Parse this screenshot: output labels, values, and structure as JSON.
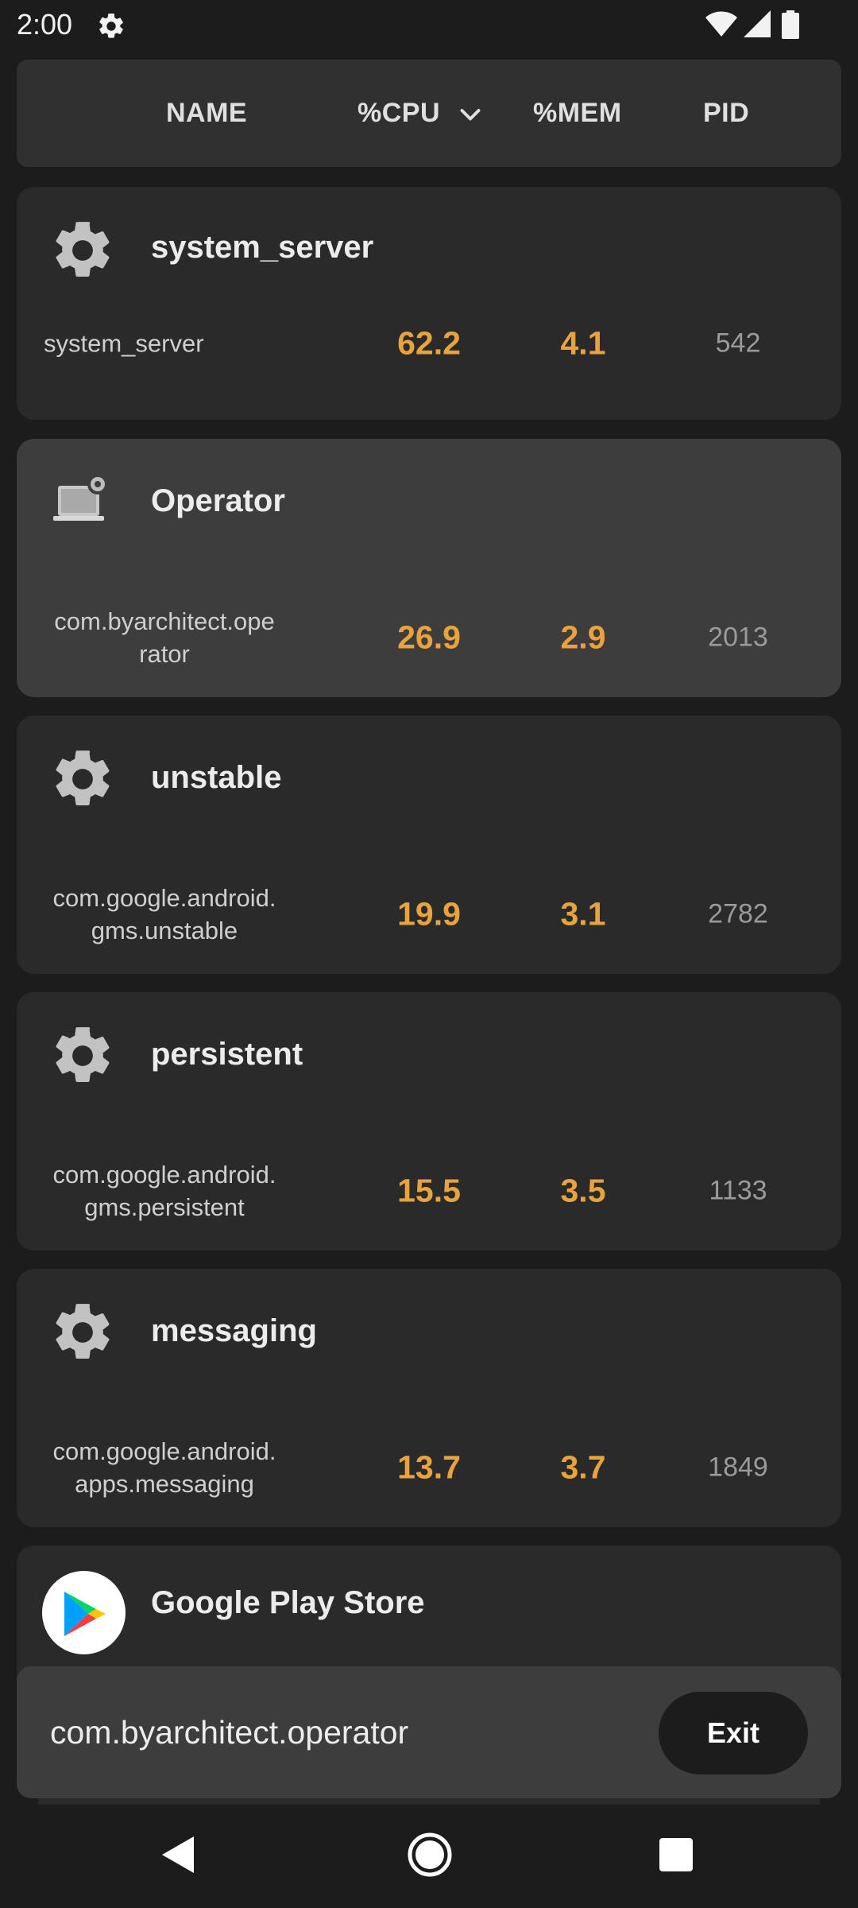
{
  "status_bar": {
    "time": "2:00",
    "icons": [
      "settings-gear-icon",
      "wifi-icon",
      "cell-signal-icon",
      "battery-icon"
    ]
  },
  "header": {
    "columns": {
      "name": "NAME",
      "cpu": "%CPU",
      "mem": "%MEM",
      "pid": "PID"
    },
    "sort_icon": "chevron-down-icon"
  },
  "processes": [
    {
      "title": "system_server",
      "package": "system_server",
      "cpu": "62.2",
      "mem": "4.1",
      "pid": "542",
      "icon": "gear-icon"
    },
    {
      "title": "Operator",
      "package": "com.byarchitect.ope\nrator",
      "cpu": "26.9",
      "mem": "2.9",
      "pid": "2013",
      "icon": "laptop-settings-icon",
      "selected": true
    },
    {
      "title": "unstable",
      "package": "com.google.android.\ngms.unstable",
      "cpu": "19.9",
      "mem": "3.1",
      "pid": "2782",
      "icon": "gear-icon"
    },
    {
      "title": "persistent",
      "package": "com.google.android.\ngms.persistent",
      "cpu": "15.5",
      "mem": "3.5",
      "pid": "1133",
      "icon": "gear-icon"
    },
    {
      "title": "messaging",
      "package": "com.google.android.\napps.messaging",
      "cpu": "13.7",
      "mem": "3.7",
      "pid": "1849",
      "icon": "gear-icon"
    },
    {
      "title": "Google Play Store",
      "icon": "google-play-icon"
    }
  ],
  "bottom_bar": {
    "package": "com.byarchitect.operator",
    "exit_label": "Exit"
  },
  "nav": {
    "icons": [
      "back-icon",
      "home-icon",
      "recents-icon"
    ]
  },
  "colors": {
    "background": "#1c1c1c",
    "card": "#2a2a2a",
    "card_selected": "#3d3d3d",
    "accent_values": "#e8a33d"
  }
}
